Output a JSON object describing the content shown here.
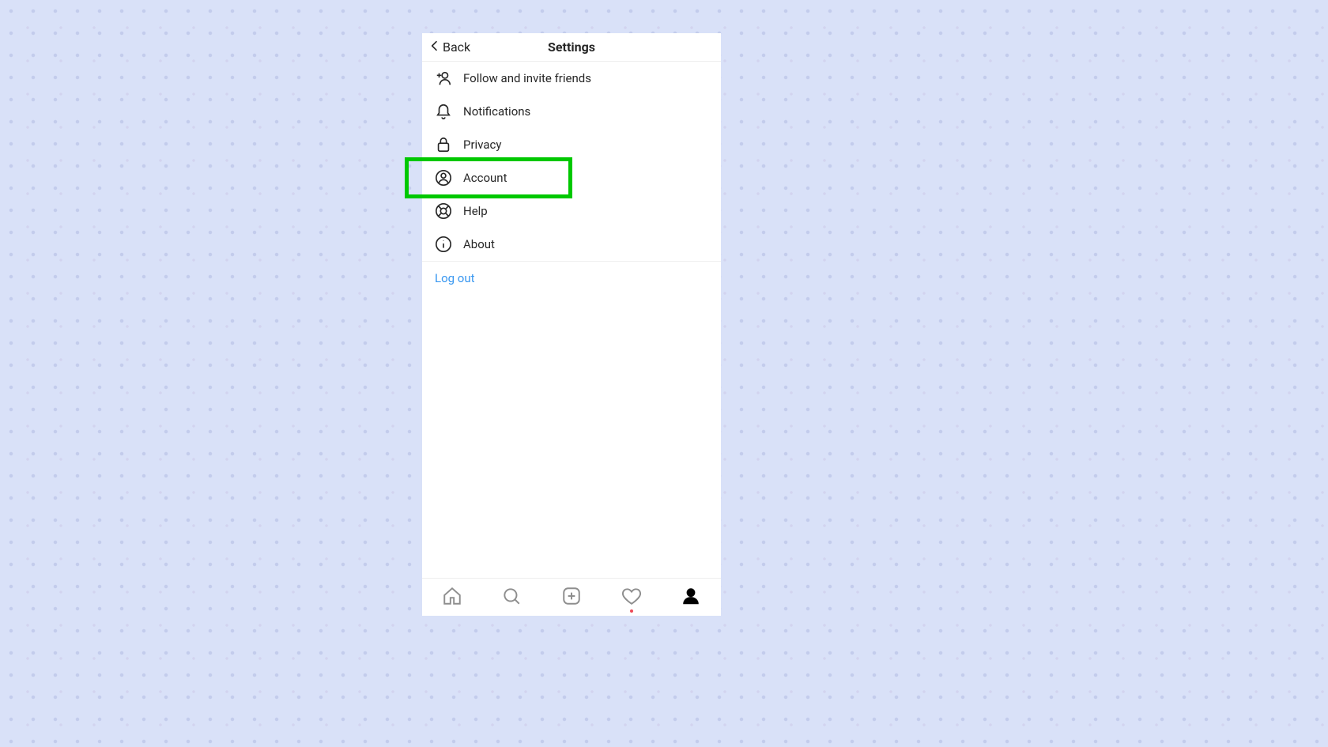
{
  "header": {
    "back_label": "Back",
    "title": "Settings"
  },
  "menu": {
    "items": [
      {
        "icon": "add-person-icon",
        "label": "Follow and invite friends",
        "highlighted": false
      },
      {
        "icon": "bell-icon",
        "label": "Notifications",
        "highlighted": false
      },
      {
        "icon": "lock-icon",
        "label": "Privacy",
        "highlighted": false
      },
      {
        "icon": "user-circle-icon",
        "label": "Account",
        "highlighted": true
      },
      {
        "icon": "lifebuoy-icon",
        "label": "Help",
        "highlighted": false
      },
      {
        "icon": "info-icon",
        "label": "About",
        "highlighted": false
      }
    ]
  },
  "logout_label": "Log out",
  "tabbar": {
    "items": [
      {
        "name": "home-tab",
        "icon": "home-icon",
        "active": false,
        "notification": false
      },
      {
        "name": "search-tab",
        "icon": "search-icon",
        "active": false,
        "notification": false
      },
      {
        "name": "create-tab",
        "icon": "create-icon",
        "active": false,
        "notification": false
      },
      {
        "name": "activity-tab",
        "icon": "heart-icon",
        "active": false,
        "notification": true
      },
      {
        "name": "profile-tab",
        "icon": "person-icon",
        "active": true,
        "notification": false
      }
    ]
  },
  "colors": {
    "highlight_border": "#00c800",
    "link": "#3897f0",
    "notification_dot": "#ed4956"
  }
}
